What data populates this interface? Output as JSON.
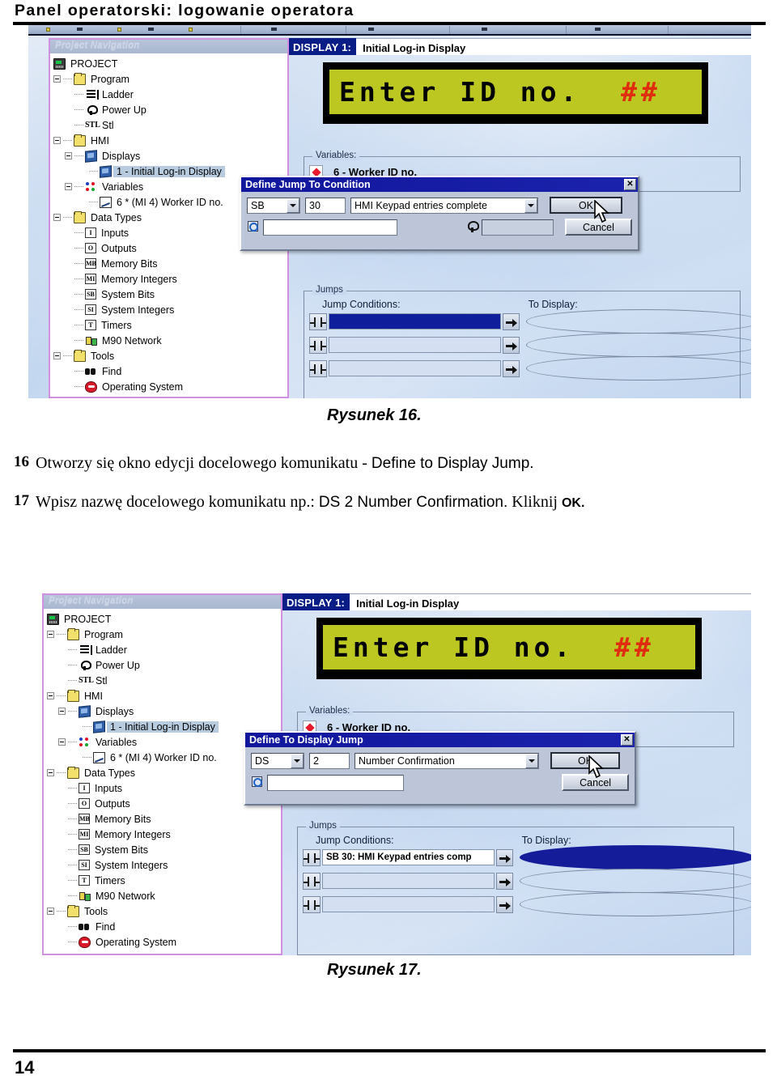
{
  "document": {
    "header_title": "Panel operatorski: logowanie operatora",
    "page_number": "14"
  },
  "figure1": {
    "caption": "Rysunek 16.",
    "nav_panel": {
      "title": "Project Navigation",
      "items": [
        {
          "label": "PROJECT",
          "icon": "plc-icon",
          "indent": 0,
          "expander": false,
          "selected": false
        },
        {
          "label": "Program",
          "icon": "folder-icon",
          "indent": 0,
          "expander": true,
          "selected": false
        },
        {
          "label": "Ladder",
          "icon": "ladder-icon",
          "indent": 1,
          "expander": false,
          "selected": false
        },
        {
          "label": "Power Up",
          "icon": "power-up-icon",
          "indent": 1,
          "expander": false,
          "selected": false
        },
        {
          "label": "Stl",
          "icon": "stl-icon",
          "indent": 1,
          "expander": false,
          "selected": false
        },
        {
          "label": "HMI",
          "icon": "folder-icon",
          "indent": 0,
          "expander": true,
          "selected": false
        },
        {
          "label": "Displays",
          "icon": "display-icon",
          "indent": 1,
          "expander": true,
          "selected": false
        },
        {
          "label": "1 - Initial Log-in Display",
          "icon": "display-icon",
          "indent": 2,
          "expander": false,
          "selected": true
        },
        {
          "label": "Variables",
          "icon": "variables-icon",
          "indent": 1,
          "expander": true,
          "selected": false
        },
        {
          "label": "6 * (MI 4)  Worker ID no.",
          "icon": "graph-icon",
          "indent": 2,
          "expander": false,
          "selected": false
        },
        {
          "label": "Data Types",
          "icon": "folder-icon",
          "indent": 0,
          "expander": true,
          "selected": false
        },
        {
          "label": "Inputs",
          "icon": "letter-I-icon",
          "indent": 1,
          "expander": false,
          "selected": false
        },
        {
          "label": "Outputs",
          "icon": "letter-O-icon",
          "indent": 1,
          "expander": false,
          "selected": false
        },
        {
          "label": "Memory Bits",
          "icon": "letter-MB-icon",
          "indent": 1,
          "expander": false,
          "selected": false
        },
        {
          "label": "Memory Integers",
          "icon": "letter-MI-icon",
          "indent": 1,
          "expander": false,
          "selected": false
        },
        {
          "label": "System Bits",
          "icon": "letter-SB-icon",
          "indent": 1,
          "expander": false,
          "selected": false
        },
        {
          "label": "System Integers",
          "icon": "letter-SI-icon",
          "indent": 1,
          "expander": false,
          "selected": false
        },
        {
          "label": "Timers",
          "icon": "letter-T-icon",
          "indent": 1,
          "expander": false,
          "selected": false
        },
        {
          "label": "M90 Network",
          "icon": "network-icon",
          "indent": 1,
          "expander": false,
          "selected": false
        },
        {
          "label": "Tools",
          "icon": "folder-icon",
          "indent": 0,
          "expander": true,
          "selected": false
        },
        {
          "label": "Find",
          "icon": "find-icon",
          "indent": 1,
          "expander": false,
          "selected": false
        },
        {
          "label": "Operating System",
          "icon": "operating-system-icon",
          "indent": 1,
          "expander": false,
          "selected": false
        }
      ]
    },
    "display": {
      "badge": "DISPLAY 1:",
      "name": "Initial Log-in Display",
      "lcd_text": "Enter ID no.",
      "lcd_hashes": "##",
      "lcd_background": "#bcc821",
      "lcd_hash_color": "#e02d10"
    },
    "variables_group": {
      "title": "Variables:",
      "rows": [
        {
          "label": "6 - Worker ID no."
        }
      ]
    },
    "jumps_group": {
      "title": "Jumps",
      "col1_label": "Jump Conditions:",
      "col2_label": "To Display:",
      "rows": [
        {
          "condition": "",
          "condition_state": "selected",
          "display": "",
          "display_state": "empty"
        },
        {
          "condition": "",
          "condition_state": "empty",
          "display": "",
          "display_state": "empty"
        },
        {
          "condition": "",
          "condition_state": "empty",
          "display": "",
          "display_state": "empty"
        }
      ]
    },
    "dialog": {
      "title": "Define Jump To Condition",
      "close_label": "✕",
      "operand_type": "SB",
      "operand_address": "30",
      "operand_description": "HMI Keypad entries complete",
      "note_value": "",
      "link_value": "",
      "ok_label": "OK",
      "cancel_label": "Cancel"
    }
  },
  "steps": [
    {
      "number": "16",
      "serif_part1": "Otworzy się okno edycji docelowego komunikatu - ",
      "sans_part": "Define to Display Jump.",
      "serif_part2": ""
    },
    {
      "number": "17",
      "serif_part1": "Wpisz nazwę docelowego komunikatu np.: ",
      "sans_part": "DS 2 Number Confirmation.",
      "serif_part2": " Kliknij ",
      "bold_tail": "OK."
    }
  ],
  "figure2": {
    "caption": "Rysunek 17.",
    "nav_panel": {
      "title": "Project Navigation",
      "items": [
        {
          "label": "PROJECT",
          "icon": "plc-icon",
          "indent": 0,
          "expander": false,
          "selected": false
        },
        {
          "label": "Program",
          "icon": "folder-icon",
          "indent": 0,
          "expander": true,
          "selected": false
        },
        {
          "label": "Ladder",
          "icon": "ladder-icon",
          "indent": 1,
          "expander": false,
          "selected": false
        },
        {
          "label": "Power Up",
          "icon": "power-up-icon",
          "indent": 1,
          "expander": false,
          "selected": false
        },
        {
          "label": "Stl",
          "icon": "stl-icon",
          "indent": 1,
          "expander": false,
          "selected": false
        },
        {
          "label": "HMI",
          "icon": "folder-icon",
          "indent": 0,
          "expander": true,
          "selected": false
        },
        {
          "label": "Displays",
          "icon": "display-icon",
          "indent": 1,
          "expander": true,
          "selected": false
        },
        {
          "label": "1 - Initial Log-in Display",
          "icon": "display-icon",
          "indent": 2,
          "expander": false,
          "selected": true
        },
        {
          "label": "Variables",
          "icon": "variables-icon",
          "indent": 1,
          "expander": true,
          "selected": false
        },
        {
          "label": "6 * (MI 4)  Worker ID no.",
          "icon": "graph-icon",
          "indent": 2,
          "expander": false,
          "selected": false
        },
        {
          "label": "Data Types",
          "icon": "folder-icon",
          "indent": 0,
          "expander": true,
          "selected": false
        },
        {
          "label": "Inputs",
          "icon": "letter-I-icon",
          "indent": 1,
          "expander": false,
          "selected": false
        },
        {
          "label": "Outputs",
          "icon": "letter-O-icon",
          "indent": 1,
          "expander": false,
          "selected": false
        },
        {
          "label": "Memory Bits",
          "icon": "letter-MB-icon",
          "indent": 1,
          "expander": false,
          "selected": false
        },
        {
          "label": "Memory Integers",
          "icon": "letter-MI-icon",
          "indent": 1,
          "expander": false,
          "selected": false
        },
        {
          "label": "System Bits",
          "icon": "letter-SB-icon",
          "indent": 1,
          "expander": false,
          "selected": false
        },
        {
          "label": "System Integers",
          "icon": "letter-SI-icon",
          "indent": 1,
          "expander": false,
          "selected": false
        },
        {
          "label": "Timers",
          "icon": "letter-T-icon",
          "indent": 1,
          "expander": false,
          "selected": false
        },
        {
          "label": "M90 Network",
          "icon": "network-icon",
          "indent": 1,
          "expander": false,
          "selected": false
        },
        {
          "label": "Tools",
          "icon": "folder-icon",
          "indent": 0,
          "expander": true,
          "selected": false
        },
        {
          "label": "Find",
          "icon": "find-icon",
          "indent": 1,
          "expander": false,
          "selected": false
        },
        {
          "label": "Operating System",
          "icon": "operating-system-icon",
          "indent": 1,
          "expander": false,
          "selected": false
        }
      ]
    },
    "display": {
      "badge": "DISPLAY 1:",
      "name": "Initial Log-in Display",
      "lcd_text": "Enter ID no.",
      "lcd_hashes": "##",
      "lcd_background": "#bcc821",
      "lcd_hash_color": "#e02d10"
    },
    "variables_group": {
      "title": "Variables:",
      "rows": [
        {
          "label": "6 - Worker ID no."
        }
      ]
    },
    "jumps_group": {
      "title": "Jumps",
      "col1_label": "Jump Conditions:",
      "col2_label": "To Display:",
      "rows": [
        {
          "condition": "SB  30: HMI Keypad entries comp",
          "condition_state": "filled",
          "display": "",
          "display_state": "selected"
        },
        {
          "condition": "",
          "condition_state": "empty",
          "display": "",
          "display_state": "empty"
        },
        {
          "condition": "",
          "condition_state": "empty",
          "display": "",
          "display_state": "empty"
        }
      ]
    },
    "dialog": {
      "title": "Define To Display Jump",
      "close_label": "✕",
      "operand_type": "DS",
      "operand_address": "2",
      "operand_description": "Number Confirmation",
      "note_value": "",
      "ok_label": "OK",
      "cancel_label": "Cancel"
    }
  }
}
